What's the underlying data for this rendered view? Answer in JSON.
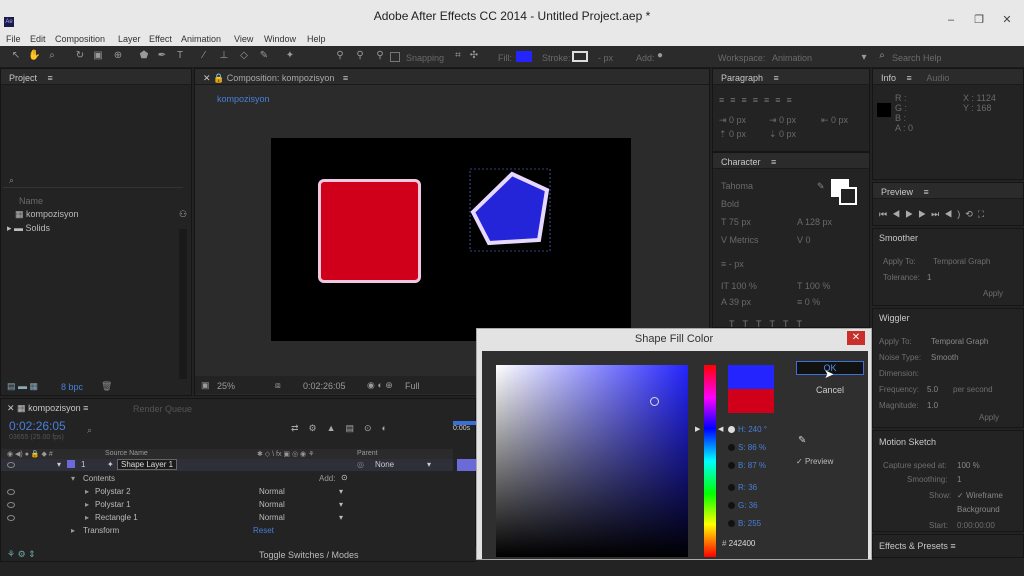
{
  "window": {
    "title": "Adobe After Effects CC 2014 - Untitled Project.aep *",
    "app_icon": "Ae"
  },
  "menu": [
    "File",
    "Edit",
    "Composition",
    "Layer",
    "Effect",
    "Animation",
    "View",
    "Window",
    "Help"
  ],
  "toolbar": {
    "snapping": "Snapping",
    "fill": "Fill:",
    "stroke": "Stroke:",
    "stroke_px": "- px",
    "add": "Add:",
    "workspace_label": "Workspace:",
    "workspace": "Animation",
    "search": "Search Help"
  },
  "project": {
    "title": "Project",
    "col_name": "Name",
    "items": [
      "kompozisyon",
      "Solids"
    ],
    "bpc": "8 bpc"
  },
  "composition": {
    "tab": "Composition: kompozisyon",
    "breadcrumb": "kompozisyon",
    "zoom": "25%",
    "timecode": "0:02:26:05",
    "resolution": "Full"
  },
  "paragraph": {
    "title": "Paragraph",
    "vals": [
      "0 px",
      "0 px",
      "0 px",
      "0 px",
      "0 px"
    ]
  },
  "character": {
    "title": "Character",
    "font": "Tahoma",
    "style": "Bold",
    "size": "75 px",
    "leading": "128 px",
    "tracking": "Metrics",
    "kern": "0",
    "stroke": "- px",
    "vscale": "100 %",
    "hscale": "100 %",
    "baseline": "39 px",
    "tsume": "0 %"
  },
  "info": {
    "title": "Info",
    "audio": "Audio",
    "r": "R :",
    "g": "G :",
    "b": "B :",
    "a": "A : 0",
    "x": "X : 1124",
    "y": "Y : 168"
  },
  "preview": {
    "title": "Preview"
  },
  "smoother": {
    "title": "Smoother",
    "apply_to_label": "Apply To:",
    "apply_to": "Temporal Graph",
    "tolerance_label": "Tolerance:",
    "tolerance": "1",
    "apply": "Apply"
  },
  "wiggler": {
    "title": "Wiggler",
    "apply_to_label": "Apply To:",
    "apply_to": "Temporal Graph",
    "noise_label": "Noise Type:",
    "noise": "Smooth",
    "dimension_label": "Dimension:",
    "freq_label": "Frequency:",
    "freq": "5.0",
    "freq_unit": "per second",
    "mag_label": "Magnitude:",
    "mag": "1.0",
    "apply": "Apply"
  },
  "motion_sketch": {
    "title": "Motion Sketch",
    "capture_label": "Capture speed at:",
    "capture": "100 %",
    "smoothing_label": "Smoothing:",
    "smoothing": "1",
    "show_label": "Show:",
    "wireframe": "Wireframe",
    "background": "Background",
    "start_label": "Start:",
    "start": "0:00:00:00"
  },
  "effects_presets": {
    "title": "Effects & Presets"
  },
  "timeline": {
    "tab": "kompozisyon",
    "render_queue": "Render Queue",
    "timecode": "0:02:26:05",
    "frames": "03655 (25.00 fps)",
    "col_source": "Source Name",
    "col_parent": "Parent",
    "layer_num": "1",
    "layer_name": "Shape Layer 1",
    "parent": "None",
    "contents": "Contents",
    "add": "Add:",
    "rows": [
      {
        "name": "Polystar 2",
        "mode": "Normal"
      },
      {
        "name": "Polystar 1",
        "mode": "Normal"
      },
      {
        "name": "Rectangle 1",
        "mode": "Normal"
      }
    ],
    "transform": "Transform",
    "reset": "Reset",
    "toggle": "Toggle Switches / Modes",
    "ruler": "0:00s"
  },
  "dialog": {
    "title": "Shape Fill Color",
    "ok": "OK",
    "cancel": "Cancel",
    "h": "H: 240 °",
    "s": "S: 86 %",
    "b": "B: 87 %",
    "r": "R: 36",
    "g": "G: 36",
    "bl": "B: 255",
    "hex": "242400",
    "preview": "Preview",
    "new_color": "#2424ff",
    "old_color": "#d0001a"
  }
}
